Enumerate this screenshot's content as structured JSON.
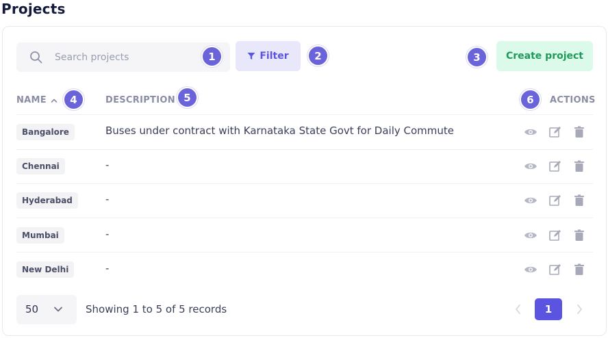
{
  "page": {
    "title": "Projects"
  },
  "search": {
    "placeholder": "Search projects",
    "value": ""
  },
  "toolbar": {
    "filter_label": "Filter",
    "create_label": "Create project"
  },
  "markers": [
    "1",
    "2",
    "3",
    "4",
    "5",
    "6"
  ],
  "table": {
    "columns": {
      "name": "NAME",
      "description": "DESCRIPTION",
      "actions": "ACTIONS"
    },
    "sort": {
      "column": "name",
      "direction": "ascending"
    },
    "rows": [
      {
        "name": "Bangalore",
        "description": "Buses under contract with Karnataka State Govt for Daily Commute"
      },
      {
        "name": "Chennai",
        "description": "-"
      },
      {
        "name": "Hyderabad",
        "description": "-"
      },
      {
        "name": "Mumbai",
        "description": "-"
      },
      {
        "name": "New Delhi",
        "description": "-"
      }
    ],
    "row_actions": [
      "eye-icon",
      "edit-icon",
      "trash-icon"
    ]
  },
  "pagination": {
    "page_size": "50",
    "records_text": "Showing 1 to 5 of 5 records",
    "current_page": "1"
  },
  "colors": {
    "accent": "#5b54e0",
    "marker": "#6b63d9",
    "create_bg": "#dcfaea",
    "create_text": "#1f9a5a",
    "filter_bg": "#e9e8fb"
  }
}
